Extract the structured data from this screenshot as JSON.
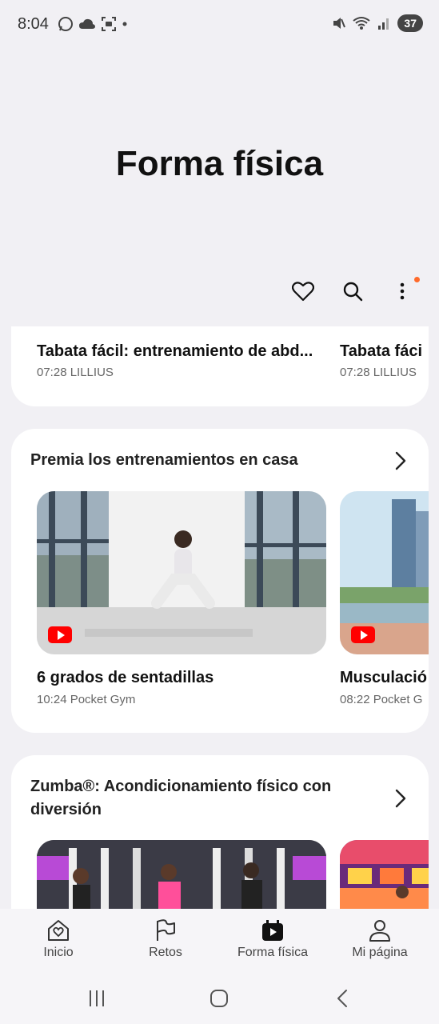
{
  "status": {
    "time": "8:04",
    "battery": "37"
  },
  "page": {
    "title": "Forma física"
  },
  "toolbar": {
    "icons": [
      "heart-icon",
      "search-icon",
      "more-vert-icon"
    ],
    "notification_dot_color": "#ff6a2b"
  },
  "card1": {
    "items": [
      {
        "title": "Tabata fácil: entrenamiento de abd...",
        "meta": "07:28 LILLIUS"
      },
      {
        "title": "Tabata fáci",
        "meta": "07:28 LILLIUS"
      }
    ]
  },
  "section1": {
    "title": "Premia los entrenamientos en casa",
    "videos": [
      {
        "title": "6 grados de sentadillas",
        "meta": "10:24 Pocket Gym"
      },
      {
        "title": "Musculació",
        "meta": "08:22 Pocket G"
      }
    ]
  },
  "section2": {
    "title_line1": "Zumba®: Acondicionamiento físico con",
    "title_line2": "diversión"
  },
  "bottom_nav": {
    "items": [
      {
        "label": "Inicio",
        "icon": "home-heart-icon"
      },
      {
        "label": "Retos",
        "icon": "flag-icon"
      },
      {
        "label": "Forma física",
        "icon": "fitness-play-icon",
        "active": true
      },
      {
        "label": "Mi página",
        "icon": "person-icon"
      }
    ]
  },
  "colors": {
    "background": "#f1f0f4",
    "card": "#ffffff",
    "youtube_red": "#ff0000"
  }
}
